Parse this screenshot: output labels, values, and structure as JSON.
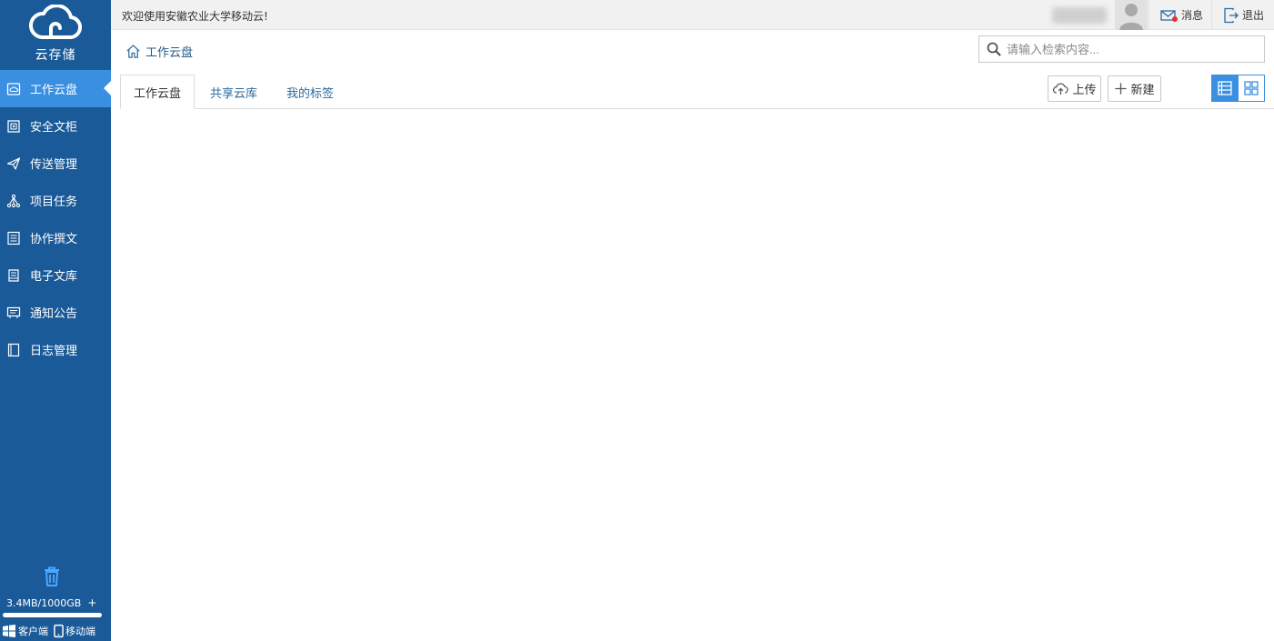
{
  "app": {
    "logo_text": "云存储"
  },
  "sidebar": {
    "items": [
      {
        "label": "工作云盘",
        "icon": "cloud-drive-icon",
        "active": true
      },
      {
        "label": "安全文柜",
        "icon": "safe-cabinet-icon",
        "active": false
      },
      {
        "label": "传送管理",
        "icon": "paper-plane-icon",
        "active": false
      },
      {
        "label": "项目任务",
        "icon": "project-tree-icon",
        "active": false
      },
      {
        "label": "协作撰文",
        "icon": "collab-doc-icon",
        "active": false
      },
      {
        "label": "电子文库",
        "icon": "e-library-icon",
        "active": false
      },
      {
        "label": "通知公告",
        "icon": "notice-board-icon",
        "active": false
      },
      {
        "label": "日志管理",
        "icon": "log-book-icon",
        "active": false
      }
    ],
    "quota": {
      "text": "3.4MB/1000GB",
      "plus": "+",
      "used_fraction": 3.4e-06
    },
    "clients": {
      "desktop": "客户端",
      "mobile": "移动端"
    }
  },
  "topbar": {
    "welcome": "欢迎使用安徽农业大学移动云!",
    "messages": "消息",
    "logout": "退出"
  },
  "breadcrumb": {
    "label": "工作云盘"
  },
  "search": {
    "placeholder": "请输入检索内容..."
  },
  "tabs": [
    {
      "label": "工作云盘",
      "active": true
    },
    {
      "label": "共享云库",
      "active": false
    },
    {
      "label": "我的标签",
      "active": false
    }
  ],
  "toolbar": {
    "upload": "上传",
    "new": "新建"
  },
  "colors": {
    "sidebar_bg": "#1a5a98",
    "accent": "#3a8fe0"
  }
}
